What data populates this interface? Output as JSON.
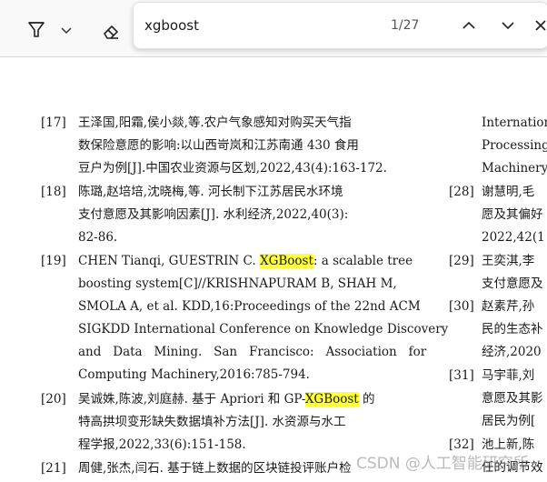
{
  "toolbar": {
    "tools": [
      "highlighter-icon",
      "chevron-down-icon",
      "eraser-icon"
    ]
  },
  "find": {
    "query": "xgboost",
    "count": "1/27"
  },
  "left_refs": [
    {
      "num": "[17]",
      "lines": [
        "王泽国,阳霜,侯小燚,等.农户气象感知对购买天气指",
        "数保险意愿的影响:以山西岢岚和江苏南通 430 食用",
        "豆户为例[J].中国农业资源与区划,2022,43(4):163-172."
      ]
    },
    {
      "num": "[18]",
      "lines": [
        "陈璐,赵培培,沈晓梅,等. 河长制下江苏居民水环境",
        "支付意愿及其影响因素[J]. 水利经济,2022,40(3):",
        "82-86."
      ]
    },
    {
      "num": "[19]",
      "lines": [
        "CHEN Tianqi, GUESTRIN C. ",
        "boosting system[C]//KRISHNAPURAM B, SHAH M,",
        "SMOLA A, et al. KDD,16:Proceedings of the 22nd ACM",
        "SIGKDD International Conference on Knowledge Discovery",
        "and   Data   Mining.   San   Francisco:   Association   for",
        "Computing Machinery,2016:785-794."
      ]
    },
    {
      "num": "[20]",
      "lines": [
        "吴诚姝,陈波,刘庭赫. 基于 Apriori 和 GP-",
        "特高拱坝变形缺失数据填补方法[J]. 水资源与水工",
        "程学报,2022,33(6):151-158."
      ]
    },
    {
      "num": "[21]",
      "lines": [
        "周健,张杰,闫石. 基于链上数据的区块链投评账户检"
      ]
    }
  ],
  "ref19_tail": ": a scalable tree",
  "ref20_tail": " 的",
  "highlight_1": "XGBoost",
  "highlight_2": "XGBoost",
  "right_refs": [
    {
      "num": "",
      "lines": [
        "International",
        "Processing.",
        "Machinery,"
      ]
    },
    {
      "num": "[28]",
      "lines": [
        "谢慧明,毛",
        "愿及其偏好",
        "2022,42(1"
      ]
    },
    {
      "num": "[29]",
      "lines": [
        "王奕淇,李",
        "支付意愿及"
      ]
    },
    {
      "num": "[30]",
      "lines": [
        "赵素芹,孙",
        "民的生态补",
        "经济,2020"
      ]
    },
    {
      "num": "[31]",
      "lines": [
        "马宇菲,刘",
        "意愿及其影",
        "居民为例["
      ]
    },
    {
      "num": "[32]",
      "lines": [
        "池上新,陈",
        "任的调节效"
      ]
    }
  ],
  "watermark": "CSDN @人工智能研究所"
}
